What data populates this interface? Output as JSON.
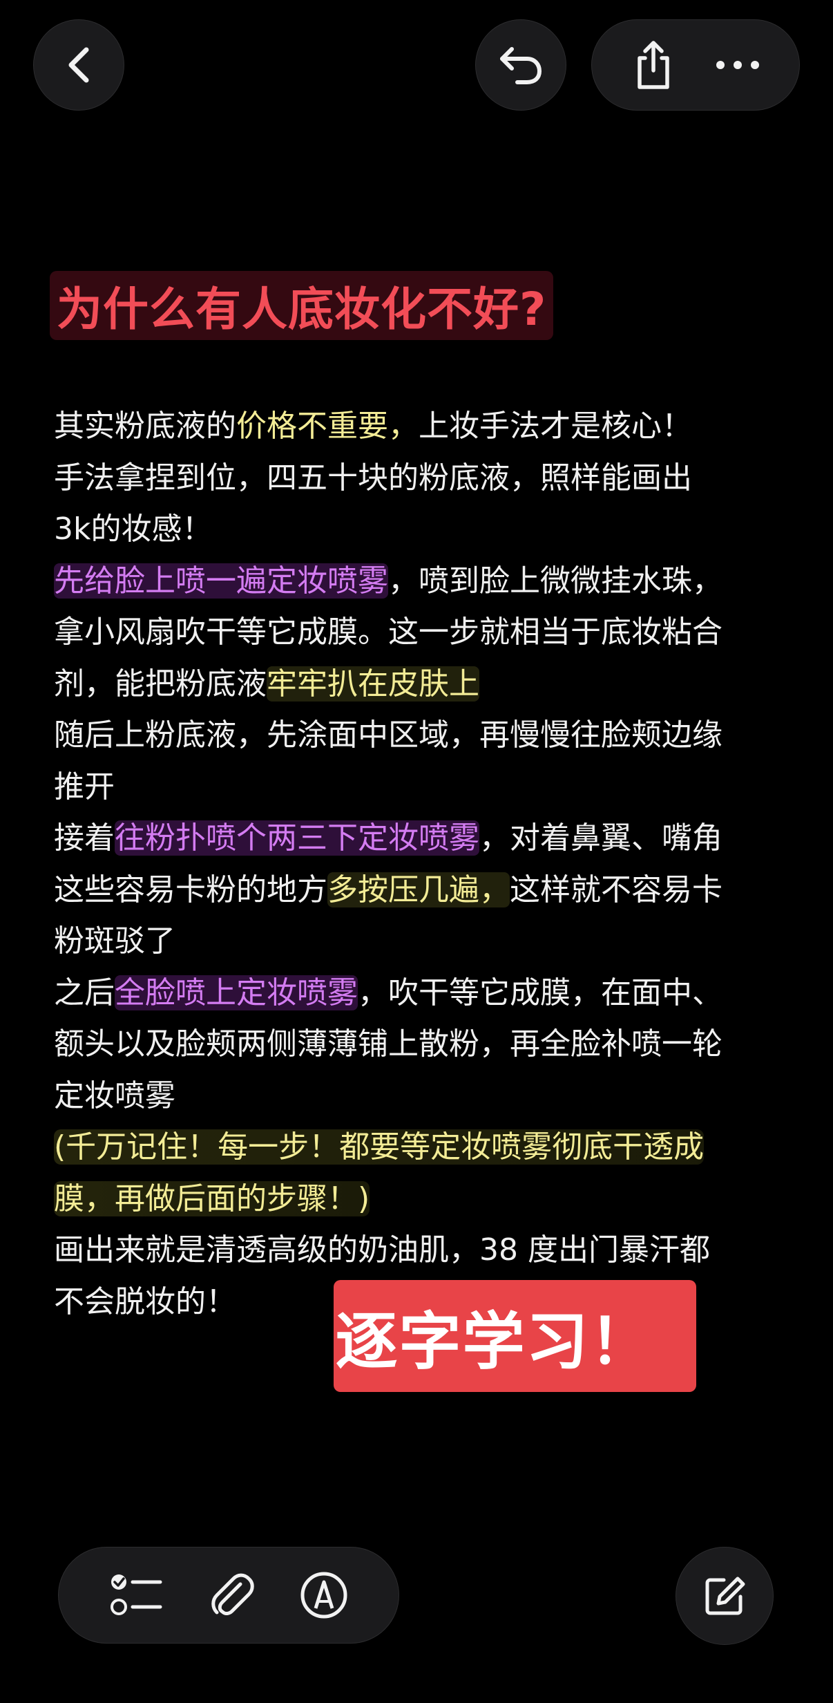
{
  "toolbar": {
    "back_icon": "chevron-left-icon",
    "undo_icon": "undo-icon",
    "share_icon": "share-icon",
    "more_icon": "more-horizontal-icon"
  },
  "note": {
    "title": "为什么有人底妆化不好?",
    "lines": [
      {
        "segments": [
          {
            "t": "其实粉底液的"
          },
          {
            "t": "价格不重要，",
            "s": "yel"
          },
          {
            "t": "上妆手法才是核心！"
          }
        ]
      },
      {
        "segments": [
          {
            "t": "手法拿捏到位，四五十块的粉底液，照样能画出"
          }
        ]
      },
      {
        "segments": [
          {
            "t": " 3k的妆感！"
          }
        ]
      },
      {
        "segments": [
          {
            "t": "先给脸上喷一遍定妆喷雾",
            "s": "pur"
          },
          {
            "t": "，喷到脸上微微挂水珠，"
          }
        ]
      },
      {
        "segments": [
          {
            "t": "拿小风扇吹干等它成膜。这一步就相当于底妆粘合"
          }
        ]
      },
      {
        "segments": [
          {
            "t": "剂，能把粉底液"
          },
          {
            "t": "牢牢扒在皮肤上",
            "s": "yel-bg"
          }
        ]
      },
      {
        "segments": [
          {
            "t": "随后上粉底液，先涂面中区域，再慢慢往脸颊边缘"
          }
        ]
      },
      {
        "segments": [
          {
            "t": "推开"
          }
        ]
      },
      {
        "segments": [
          {
            "t": "接着"
          },
          {
            "t": "往粉扑喷个两三下定妆喷雾",
            "s": "pur"
          },
          {
            "t": "，对着鼻翼、嘴角"
          }
        ]
      },
      {
        "segments": [
          {
            "t": "这些容易卡粉的地方"
          },
          {
            "t": "多按压几遍，",
            "s": "yel-bg"
          },
          {
            "t": "这样就不容易卡"
          }
        ]
      },
      {
        "segments": [
          {
            "t": "粉斑驳了"
          }
        ]
      },
      {
        "segments": [
          {
            "t": "之后"
          },
          {
            "t": "全脸喷上定妆喷雾",
            "s": "pur"
          },
          {
            "t": "，吹干等它成膜，在面中、"
          }
        ]
      },
      {
        "segments": [
          {
            "t": "额头以及脸颊两侧薄薄铺上散粉，再全脸补喷一轮"
          }
        ]
      },
      {
        "segments": [
          {
            "t": "定妆喷雾"
          }
        ]
      },
      {
        "segments": [
          {
            "t": "(千万记住！每一步！都要等定妆喷雾彻底干透成",
            "s": "hl-line"
          }
        ]
      },
      {
        "segments": [
          {
            "t": "膜，再做后面的步骤！)",
            "s": "hl-line"
          }
        ]
      },
      {
        "segments": [
          {
            "t": "画出来就是清透高级的奶油肌，38 度出门暴汗都"
          }
        ]
      },
      {
        "segments": [
          {
            "t": "不会脱妆的！"
          }
        ]
      }
    ],
    "sticker": "逐字学习！"
  },
  "bottom_bar": {
    "checklist_icon": "checklist-icon",
    "attachment_icon": "paperclip-icon",
    "markup_icon": "pen-markup-icon",
    "compose_icon": "compose-icon"
  },
  "colors": {
    "background": "#000000",
    "title": "#f24d57",
    "highlight_yellow": "#f3ec96",
    "highlight_purple": "#d47cf2",
    "sticker": "#e84448"
  }
}
